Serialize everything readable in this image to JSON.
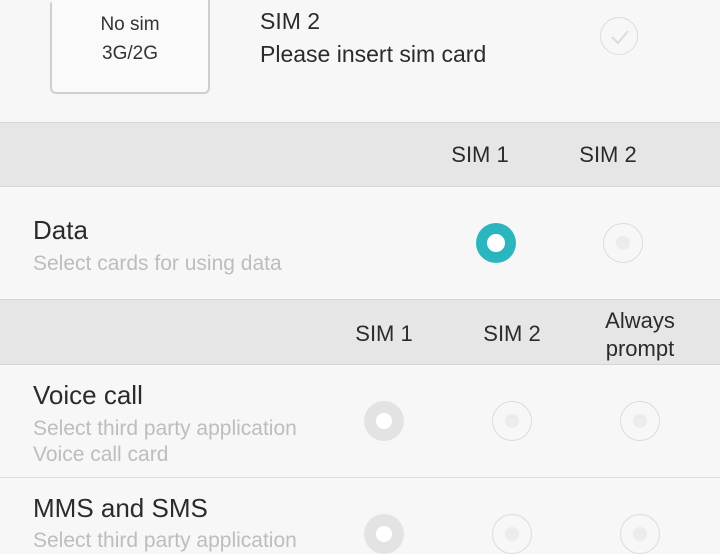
{
  "sim_card": {
    "status": "No sim",
    "network": "3G/2G",
    "title": "SIM 2",
    "subtitle": "Please insert sim card"
  },
  "data_header": {
    "col1": "SIM 1",
    "col2": "SIM 2"
  },
  "data_row": {
    "title": "Data",
    "subtitle": "Select cards for using data",
    "selected": "SIM 1"
  },
  "calls_header": {
    "col1": "SIM 1",
    "col2": "SIM 2",
    "col3_line1": "Always",
    "col3_line2": "prompt"
  },
  "voice_row": {
    "title": "Voice call",
    "subtitle_line1": "Select third party application",
    "subtitle_line2": "Voice call card"
  },
  "mms_row": {
    "title": "MMS and SMS",
    "subtitle_line1": "Select third party application"
  },
  "colors": {
    "accent": "#2bb5bf",
    "band": "#e6e6e6",
    "background": "#f7f7f7"
  },
  "icons": {
    "sim": "sim-card-icon",
    "check": "check-icon"
  }
}
